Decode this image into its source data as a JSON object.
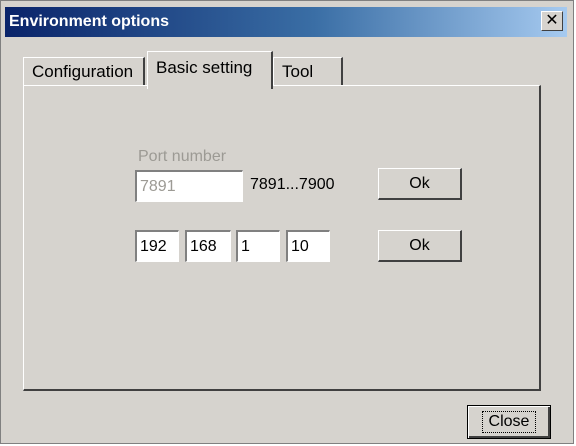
{
  "window": {
    "title": "Environment options",
    "close_glyph": "✕"
  },
  "tabs": [
    {
      "label": "Configuration",
      "active": false
    },
    {
      "label": "Basic setting",
      "active": true
    },
    {
      "label": "Tool",
      "active": false
    }
  ],
  "port": {
    "label": "Port number",
    "value": "7891",
    "range": "7891...7900",
    "ok_label": "Ok"
  },
  "ip": {
    "octets": [
      "192",
      "168",
      "1",
      "10"
    ],
    "ok_label": "Ok"
  },
  "footer": {
    "close_label": "Close"
  },
  "colors": {
    "face": "#d6d3ce",
    "title_start": "#0a246a",
    "title_end": "#a6caf0",
    "disabled_text": "#9c9a94"
  },
  "icons": {
    "close": "close-icon"
  }
}
